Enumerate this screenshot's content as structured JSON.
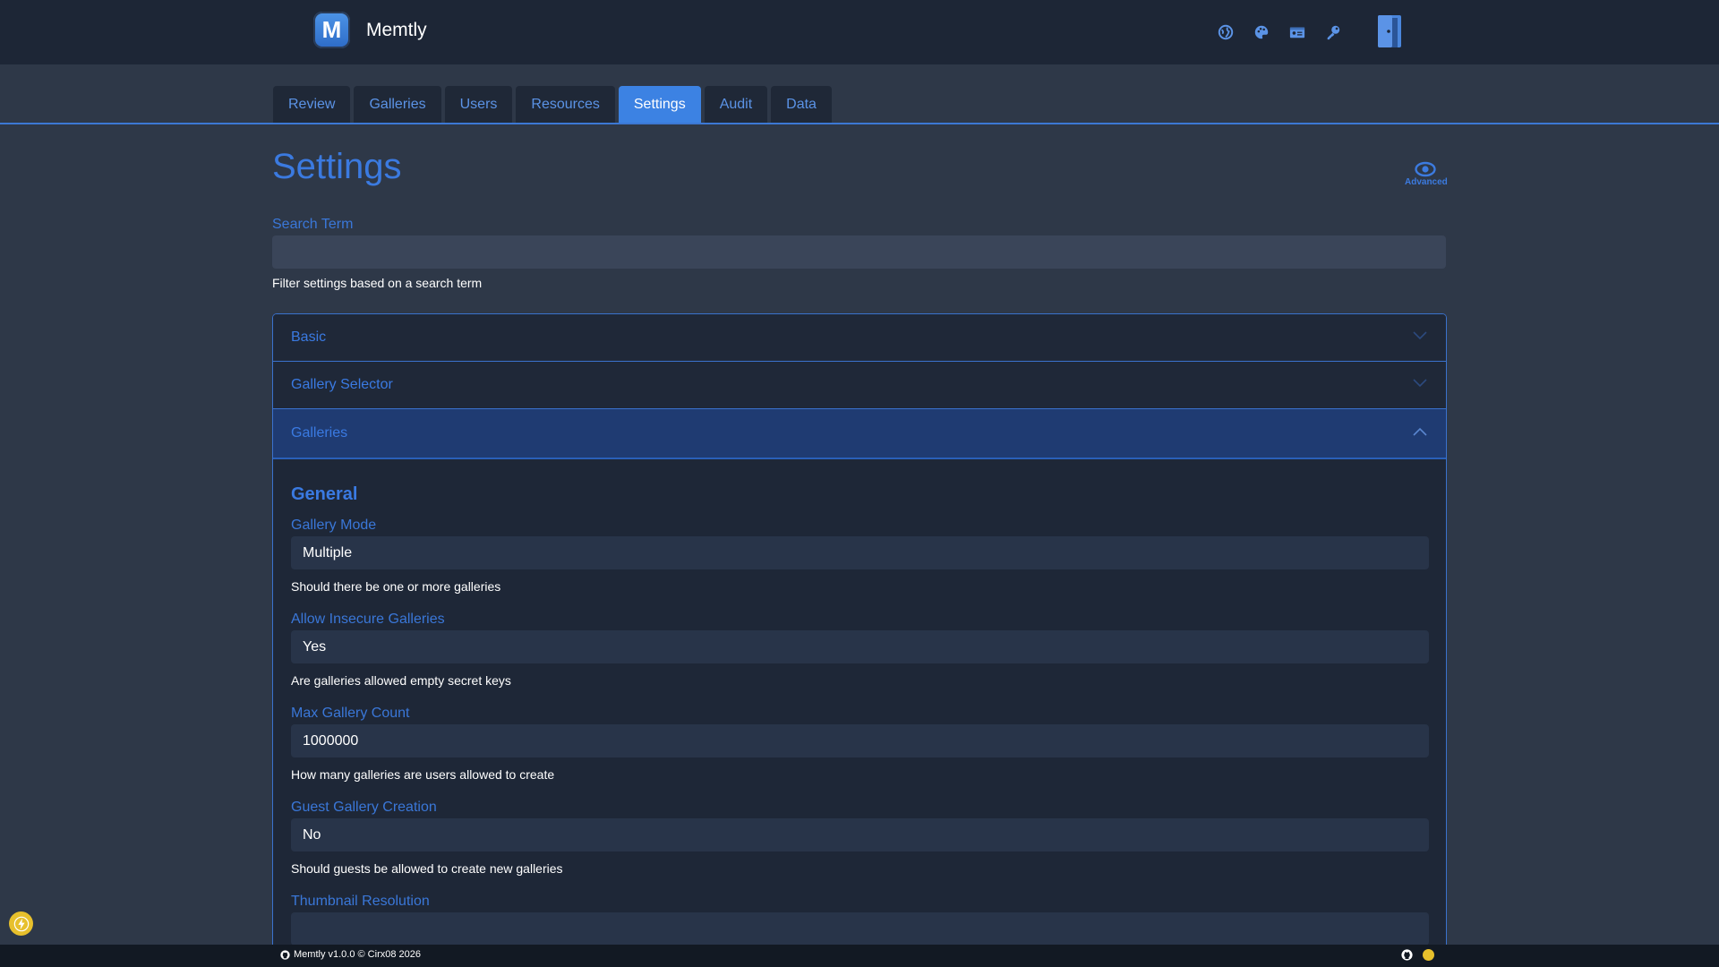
{
  "app": {
    "name": "Memtly",
    "logo_letter": "M"
  },
  "header_icons": [
    "globe-icon",
    "palette-icon",
    "id-card-icon",
    "key-icon",
    "logout-door-icon"
  ],
  "tabs": [
    {
      "label": "Review",
      "active": false
    },
    {
      "label": "Galleries",
      "active": false
    },
    {
      "label": "Users",
      "active": false
    },
    {
      "label": "Resources",
      "active": false
    },
    {
      "label": "Settings",
      "active": true
    },
    {
      "label": "Audit",
      "active": false
    },
    {
      "label": "Data",
      "active": false
    }
  ],
  "page": {
    "title": "Settings",
    "advanced_label": "Advanced",
    "search": {
      "label": "Search Term",
      "value": "",
      "help": "Filter settings based on a search term"
    }
  },
  "accordion": {
    "sections": [
      {
        "label": "Basic",
        "open": false
      },
      {
        "label": "Gallery Selector",
        "open": false
      },
      {
        "label": "Galleries",
        "open": true
      }
    ],
    "open_body": {
      "section_title": "General",
      "fields": [
        {
          "label": "Gallery Mode",
          "value": "Multiple",
          "help": "Should there be one or more galleries"
        },
        {
          "label": "Allow Insecure Galleries",
          "value": "Yes",
          "help": "Are galleries allowed empty secret keys"
        },
        {
          "label": "Max Gallery Count",
          "value": "1000000",
          "help": "How many galleries are users allowed to create"
        },
        {
          "label": "Guest Gallery Creation",
          "value": "No",
          "help": "Should guests be allowed to create new galleries"
        },
        {
          "label": "Thumbnail Resolution",
          "value": "",
          "help": ""
        }
      ]
    }
  },
  "footer": {
    "text": "Memtly v1.0.0 © Cirx08 2026"
  },
  "colors": {
    "accent": "#3c82e3",
    "background": "#2e3848",
    "navbar": "#1d2636",
    "coin": "#e7c02c"
  }
}
